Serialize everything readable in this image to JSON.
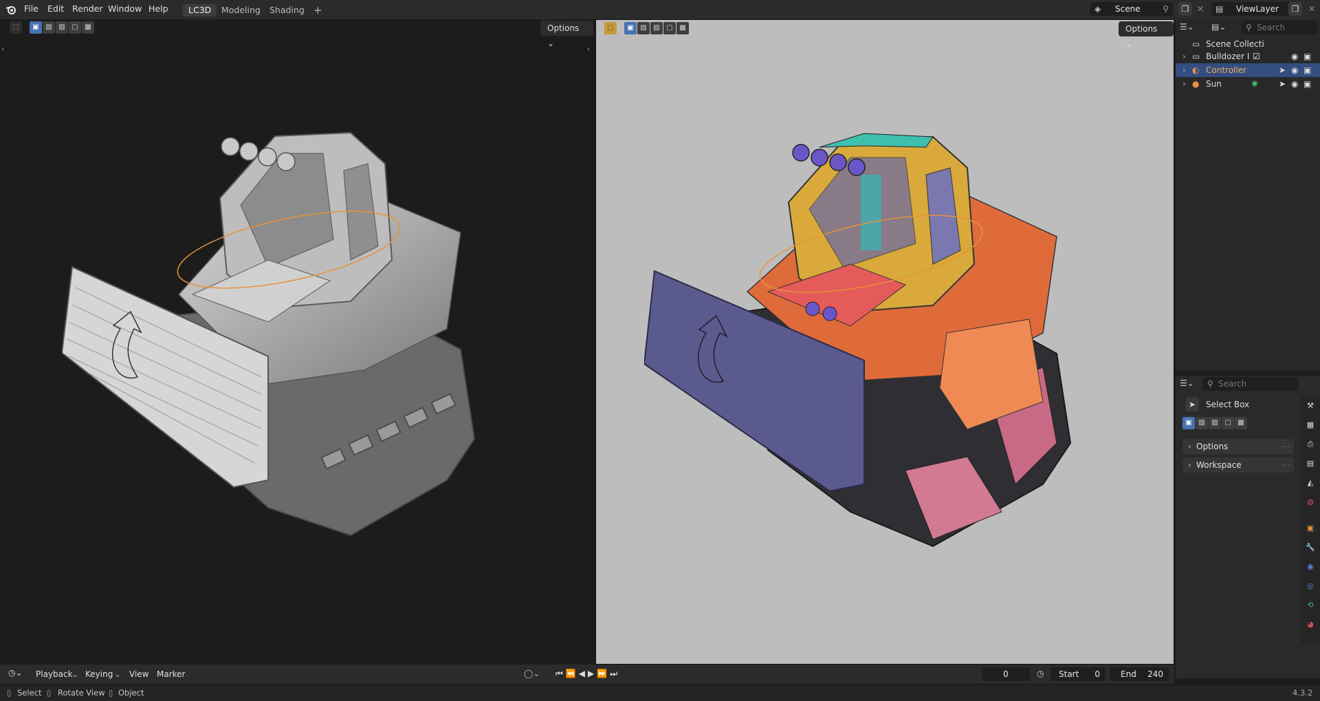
{
  "topbar": {
    "menus": [
      "File",
      "Edit",
      "Render",
      "Window",
      "Help"
    ],
    "workspaces": [
      {
        "label": "LC3D",
        "active": true
      },
      {
        "label": "Modeling",
        "active": false
      },
      {
        "label": "Shading",
        "active": false
      }
    ],
    "add_workspace": "+",
    "scene": "Scene",
    "view_layer": "ViewLayer"
  },
  "viewport_left": {
    "options_label": "Options"
  },
  "viewport_right": {
    "options_label": "Options"
  },
  "outliner": {
    "search_placeholder": "Search",
    "root": "Scene Collecti",
    "items": [
      {
        "label": "Bulldozer I",
        "selected": false
      },
      {
        "label": "Controller",
        "selected": true
      },
      {
        "label": "Sun",
        "selected": false
      }
    ]
  },
  "properties": {
    "search_placeholder": "Search",
    "tool_name": "Select Box",
    "panels": [
      "Options",
      "Workspace"
    ]
  },
  "timeline": {
    "menus": [
      "Playback",
      "Keying",
      "View",
      "Marker"
    ],
    "current_frame": "0",
    "start_label": "Start",
    "start_value": "0",
    "end_label": "End",
    "end_value": "240"
  },
  "statusbar": {
    "select": "Select",
    "rotate": "Rotate View",
    "object": "Object",
    "version": "4.3.2"
  },
  "colors": {
    "accent": "#4772b3",
    "selection_outline": "#e8923a",
    "blade": "#5a5a8e",
    "cab": "#d9aa3b",
    "body": "#e06b3a",
    "track": "#2a2a2a"
  }
}
